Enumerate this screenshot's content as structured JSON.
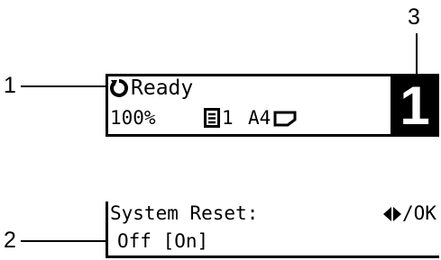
{
  "callouts": {
    "n1": "1",
    "n2": "2",
    "n3": "3"
  },
  "screen1": {
    "status": "Ready",
    "zoom": "100%",
    "copies": "1",
    "paper_size": "A4",
    "counter": "1"
  },
  "screen2": {
    "title": "System Reset:",
    "hint": "/OK",
    "options": "Off [On]"
  },
  "icons": {
    "status_icon": "ready-ring-icon",
    "copies_icon": "document-stack-icon",
    "paper_orientation_icon": "paper-landscape-icon",
    "nav_icon": "left-right-arrows-icon"
  }
}
